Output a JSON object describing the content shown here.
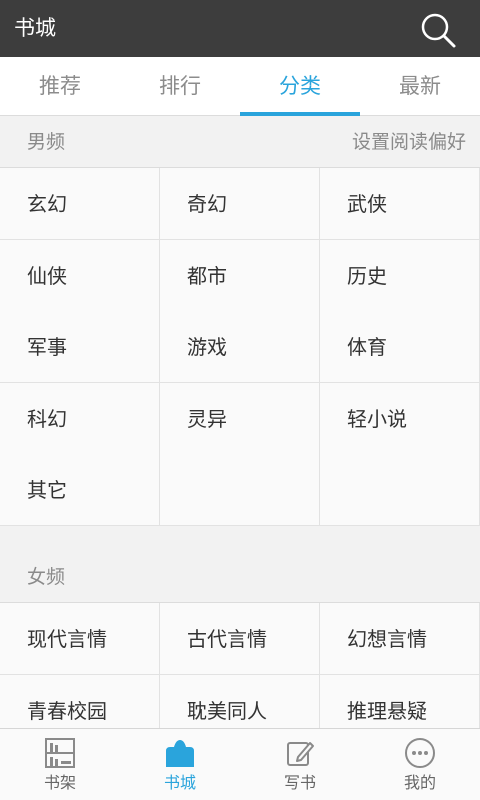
{
  "header": {
    "title": "书城",
    "search_icon": "search-icon"
  },
  "tabs": [
    {
      "label": "推荐",
      "active": false
    },
    {
      "label": "排行",
      "active": false
    },
    {
      "label": "分类",
      "active": true
    },
    {
      "label": "最新",
      "active": false
    }
  ],
  "sections": {
    "male": {
      "title": "男频",
      "preference_link": "设置阅读偏好",
      "categories": [
        "玄幻",
        "奇幻",
        "武侠",
        "仙侠",
        "都市",
        "历史",
        "军事",
        "游戏",
        "体育",
        "科幻",
        "灵异",
        "轻小说",
        "其它"
      ]
    },
    "female": {
      "title": "女频",
      "categories": [
        "现代言情",
        "古代言情",
        "幻想言情",
        "青春校园",
        "耽美同人",
        "推理悬疑"
      ]
    }
  },
  "bottom_nav": [
    {
      "label": "书架",
      "icon": "bookshelf-icon",
      "active": false
    },
    {
      "label": "书城",
      "icon": "bookstore-icon",
      "active": true
    },
    {
      "label": "写书",
      "icon": "write-icon",
      "active": false
    },
    {
      "label": "我的",
      "icon": "more-icon",
      "active": false
    }
  ],
  "colors": {
    "accent": "#2aa4dc",
    "topbar": "#3d3d3d"
  }
}
